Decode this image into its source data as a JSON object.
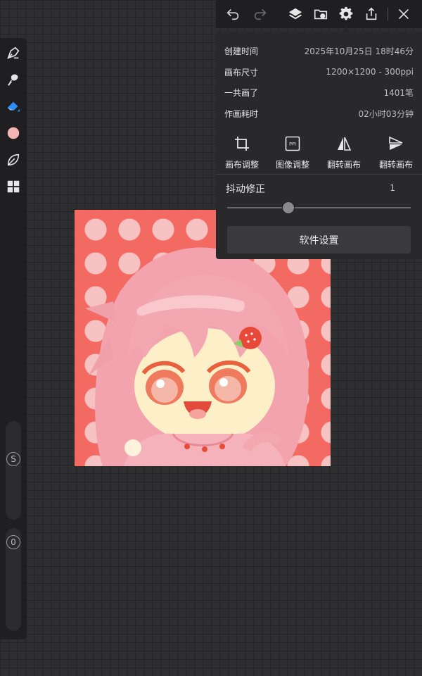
{
  "info": [
    {
      "label": "创建时间",
      "value": "2025年10月25日 18时46分"
    },
    {
      "label": "画布尺寸",
      "value": "1200×1200 - 300ppi"
    },
    {
      "label": "一共画了",
      "value": "1401笔"
    },
    {
      "label": "作画耗时",
      "value": "02小时03分钟"
    }
  ],
  "actions": [
    {
      "label": "画布调整",
      "icon": "crop-icon"
    },
    {
      "label": "图像调整",
      "icon": "ppi-icon",
      "icon_text": "PPI"
    },
    {
      "label": "翻转画布",
      "icon": "flip-horizontal-icon"
    },
    {
      "label": "翻转画布",
      "icon": "flip-vertical-icon"
    }
  ],
  "stabilizer": {
    "label": "抖动修正",
    "value": "1"
  },
  "settings_button": "软件设置",
  "sliders": {
    "size_label": "S",
    "opacity_label": "0"
  },
  "colors": {
    "current_color": "#f4b5b5",
    "accent": "#2f8cff",
    "canvas_bg": "#2e2e30"
  }
}
